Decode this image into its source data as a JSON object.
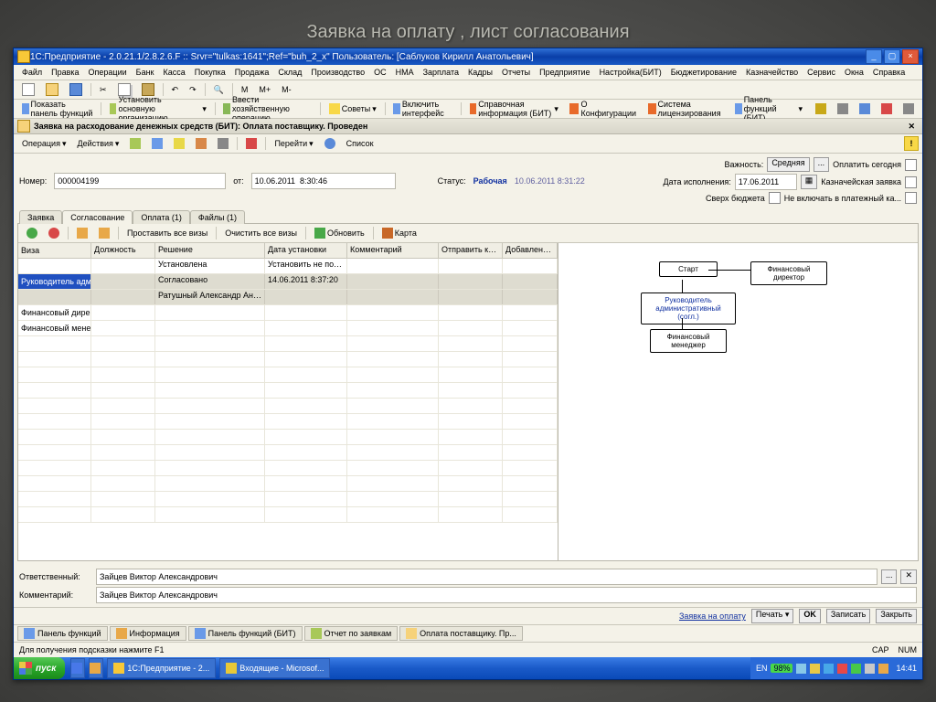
{
  "slide_title": "Заявка на оплату , лист согласования",
  "titlebar": "1С:Предприятие - 2.0.21.1/2.8.2.6.F  ::  Srvr=\"tulkas:1641\";Ref=\"buh_2_x\" Пользователь: [Саблуков Кирилл Анатольевич]",
  "win_btns": {
    "min": "_",
    "max": "▢",
    "close": "×"
  },
  "menubar": [
    "Файл",
    "Правка",
    "Операции",
    "Банк",
    "Касса",
    "Покупка",
    "Продажа",
    "Склад",
    "Производство",
    "ОС",
    "НМА",
    "Зарплата",
    "Кадры",
    "Отчеты",
    "Предприятие",
    "Настройка(БИТ)",
    "Бюджетирование",
    "Казначейство",
    "Сервис",
    "Окна",
    "Справка"
  ],
  "toolbar1_nav": [
    "M",
    "M+",
    "M-"
  ],
  "toolbar2": {
    "show_panel": "Показать панель функций",
    "set_org": "Установить основную организацию",
    "enter_op": "Ввести хозяйственную операцию",
    "advices": "Советы",
    "enable_ui": "Включить интерфейс",
    "ref_info": "Справочная информация (БИТ)",
    "about": "О Конфигурации",
    "license": "Система лицензирования",
    "panel_bit": "Панель функций (БИТ)"
  },
  "doc_title": "Заявка на расходование денежных средств (БИТ): Оплата поставщику. Проведен",
  "doc_toolbar": {
    "operation": "Операция",
    "actions": "Действия",
    "goto": "Перейти",
    "list": "Список"
  },
  "form": {
    "number_label": "Номер:",
    "number": "000004199",
    "from_label": "от:",
    "from_date": "10.06.2011  8:30:46",
    "status_label": "Статус:",
    "status": "Рабочая",
    "status_date": "10.06.2011  8:31:22",
    "importance_label": "Важность:",
    "importance": "Средняя",
    "pay_today": "Оплатить сегодня",
    "exec_date_label": "Дата исполнения:",
    "exec_date": "17.06.2011",
    "treasury": "Казначейская заявка",
    "budget_check": "Сверх бюджета",
    "exclude_plan": "Не включать в платежный ка..."
  },
  "tabs": [
    "Заявка",
    "Согласование",
    "Оплата (1)",
    "Файлы (1)"
  ],
  "tabs_active": 1,
  "subtoolbar": {
    "set_all": "Проставить все визы",
    "clear_all": "Очистить все визы",
    "refresh": "Обновить",
    "map": "Карта"
  },
  "grid": {
    "headers": [
      "Виза",
      "Должность",
      "Решение",
      "Дата установки",
      "Комментарий",
      "Отправить комментарий",
      "Добавлена вручную"
    ],
    "rows": [
      {
        "bar": "",
        "c0": "",
        "c1": "",
        "c2": "Установлена",
        "c3": "Установить не позднее",
        "c4": "",
        "c5": "",
        "c6": ""
      },
      {
        "bar": "blue",
        "c0": "Руководитель административный",
        "sel": true,
        "c1": "",
        "c2": "Согласовано",
        "c3": "14.06.2011 8:37:20",
        "c4": "",
        "c5": "",
        "c6": ""
      },
      {
        "bar": "",
        "c0": "",
        "sel": true,
        "c1": "",
        "c2": "Ратушный Александр Анатольевич",
        "c3": "",
        "c4": "",
        "c5": "",
        "c6": ""
      },
      {
        "bar": "red",
        "c0": "Финансовый директор",
        "c1": "",
        "c2": "",
        "c3": "",
        "c4": "",
        "c5": "",
        "c6": ""
      },
      {
        "bar": "red",
        "c0": "Финансовый менеджер (согл.)",
        "c1": "",
        "c2": "",
        "c3": "",
        "c4": "",
        "c5": "",
        "c6": ""
      }
    ]
  },
  "diagram": {
    "start": "Старт",
    "fd": "Финансовый директор",
    "ra": "Руководитель административный (согл.)",
    "fm": "Финансовый менеджер"
  },
  "footer": {
    "resp_label": "Ответственный:",
    "resp": "Зайцев Виктор Александрович",
    "comment_label": "Комментарий:",
    "comment": "Зайцев Виктор Александрович"
  },
  "doc_footer": {
    "link": "Заявка на оплату",
    "print": "Печать",
    "ok": "OK",
    "save": "Записать",
    "close": "Закрыть"
  },
  "panel_tabs": [
    "Панель функций",
    "Информация",
    "Панель функций (БИТ)",
    "Отчет по заявкам",
    "Оплата поставщику. Пр..."
  ],
  "statusbar": {
    "hint": "Для получения подсказки нажмите F1",
    "cap": "CAP",
    "num": "NUM"
  },
  "taskbar": {
    "start": "пуск",
    "tasks": [
      "1С:Предприятие - 2...",
      "Входящие - Microsof..."
    ],
    "lang": "EN",
    "battery": "98%",
    "clock": "14:41"
  }
}
